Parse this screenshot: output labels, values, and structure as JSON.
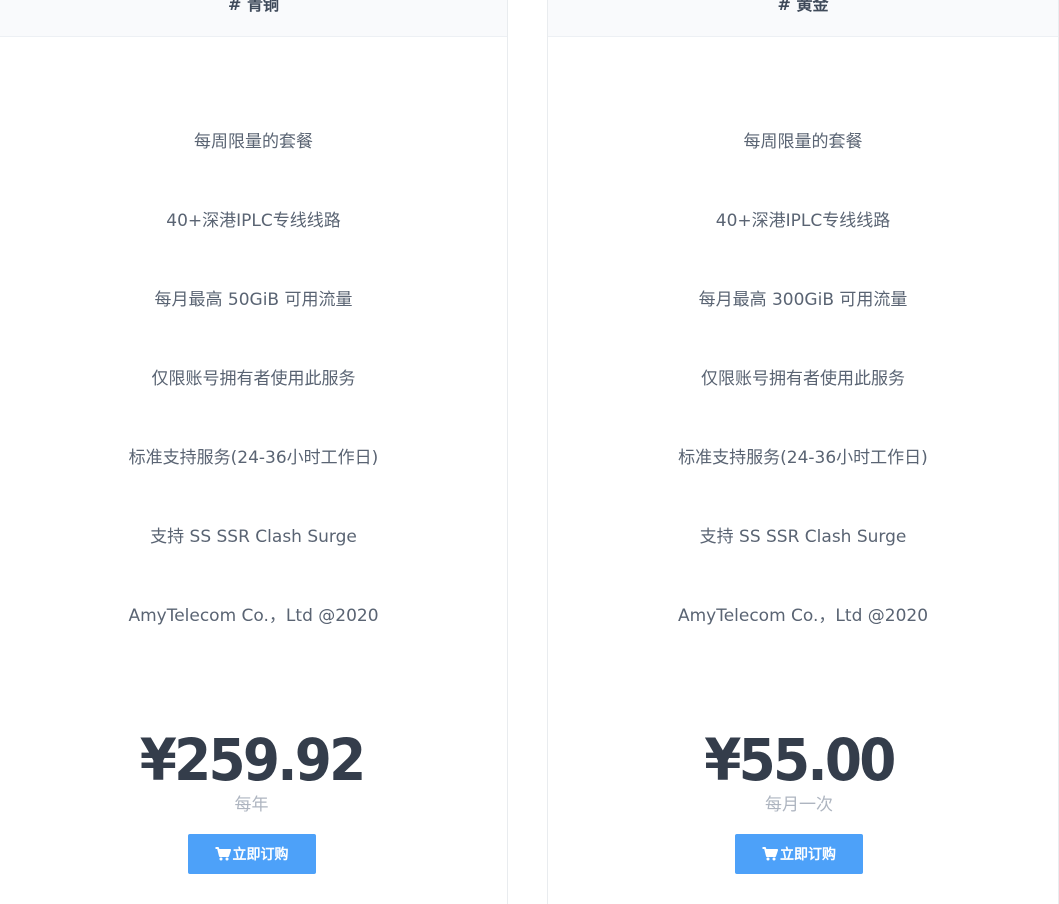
{
  "plans": [
    {
      "title": "# 青铜",
      "features": [
        "每周限量的套餐",
        "40+深港IPLC专线线路",
        "每月最高 50GiB 可用流量",
        "仅限账号拥有者使用此服务",
        "标准支持服务(24-36小时工作日)",
        "支持 SS SSR Clash Surge",
        "AmyTelecom Co.，Ltd @2020"
      ],
      "price": "¥259.92",
      "period": "每年",
      "button_label": "立即订购",
      "button_icon": "cart-icon"
    },
    {
      "title": "# 黄金",
      "features": [
        "每周限量的套餐",
        "40+深港IPLC专线线路",
        "每月最高 300GiB 可用流量",
        "仅限账号拥有者使用此服务",
        "标准支持服务(24-36小时工作日)",
        "支持 SS SSR Clash Surge",
        "AmyTelecom Co.，Ltd @2020"
      ],
      "price": "¥55.00",
      "period": "每月一次",
      "button_label": "立即订购",
      "button_icon": "cart-icon"
    }
  ],
  "colors": {
    "button": "#4da1f9",
    "price": "#343d4b",
    "feature_text": "#5a6473",
    "period_text": "#aeb5c0",
    "header_bg": "#f9fafc"
  }
}
